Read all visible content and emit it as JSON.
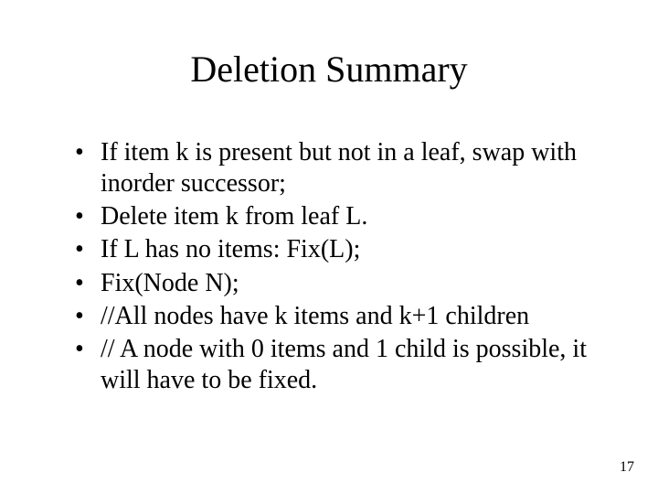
{
  "slide": {
    "title": "Deletion Summary",
    "bullets": [
      "If item k is present but not in a leaf, swap with inorder successor;",
      "Delete item k from leaf L.",
      "If L has no items: Fix(L);",
      "Fix(Node  N);",
      "//All nodes have k items and k+1 children",
      "// A node with 0 items and 1 child is possible, it will have to be fixed."
    ],
    "page_number": "17"
  }
}
